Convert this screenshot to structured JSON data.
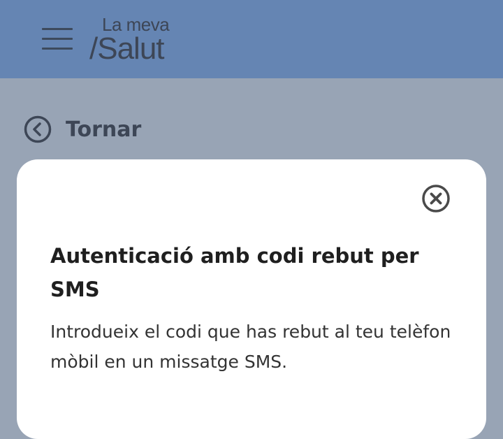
{
  "header": {
    "menu_icon": "hamburger-menu-icon",
    "logo": {
      "line1": "La meva",
      "line2": "/Salut"
    }
  },
  "back_link": {
    "icon": "chevron-left-circle-icon",
    "label": "Tornar"
  },
  "modal": {
    "close_icon": "close-circle-icon",
    "title": "Autenticació amb codi rebut per SMS",
    "description": "Introdueix el codi que has rebut al teu telèfon mòbil en un missatge SMS."
  },
  "colors": {
    "header_bg": "#6585b3",
    "overlay_bg": "#98a4b5",
    "modal_bg": "#ffffff",
    "text_dark": "#3d4656"
  }
}
